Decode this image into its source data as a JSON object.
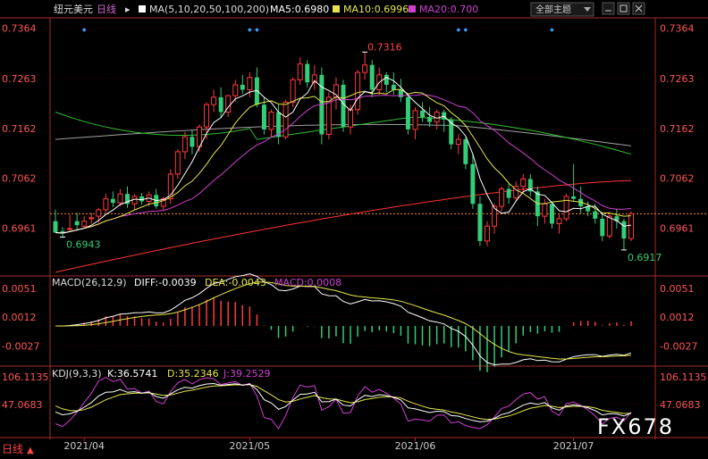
{
  "header": {
    "symbol": "纽元美元",
    "period": "日线",
    "ma_label": "MA(5,10,20,50,100,200)",
    "ma5": "MA5:0.6980",
    "ma10": "MA10:0.6996",
    "ma20": "MA20:0.700",
    "layout_select": "全部主题"
  },
  "macd_legend": {
    "title": "MACD(26,12,9)",
    "diff": "DIFF:-0.0039",
    "dea": "DEA:-0.0043",
    "macd": "MACD:0.0008"
  },
  "kdj_legend": {
    "title": "KDJ(9,3,3)",
    "k": "K:36.5741",
    "d": "D:35.2346",
    "j": "J:39.2529"
  },
  "bottom": {
    "period_label": "日线"
  },
  "watermark": "FX678",
  "colors": {
    "up": "#ff3b3b",
    "down": "#33cc77",
    "ma5": "#ffffff",
    "ma10": "#e6e64c",
    "ma20": "#d040d0",
    "ma50": "#30c030",
    "ma100": "#a0a0a0",
    "ma200": "#ff3333",
    "grid": "#3a0000",
    "axis": "#aa2a2a"
  },
  "chart_data": [
    {
      "type": "candlestick",
      "yticks": [
        "0.7364",
        "0.7263",
        "0.7162",
        "0.7062",
        "0.6961"
      ],
      "ylim": [
        0.687,
        0.7385
      ],
      "xticks": [
        "2021/04",
        "2021/05",
        "2021/06",
        "2021/07"
      ],
      "xtick_index": [
        4,
        27,
        50,
        72
      ],
      "high_annotation": {
        "label": "0.7316",
        "index": 43,
        "value": 0.7316
      },
      "low_annotations": [
        {
          "label": "0.6943",
          "index": 1,
          "value": 0.6943
        },
        {
          "label": "0.6917",
          "index": 79,
          "value": 0.6917
        }
      ],
      "ohlc": [
        [
          0.6975,
          0.6998,
          0.6955,
          0.6952
        ],
        [
          0.6955,
          0.6963,
          0.6943,
          0.695
        ],
        [
          0.696,
          0.6988,
          0.6955,
          0.696
        ],
        [
          0.6975,
          0.6992,
          0.6958,
          0.6967
        ],
        [
          0.6965,
          0.6985,
          0.696,
          0.6975
        ],
        [
          0.698,
          0.6992,
          0.697,
          0.6982
        ],
        [
          0.6985,
          0.7002,
          0.6972,
          0.6998
        ],
        [
          0.6998,
          0.703,
          0.6992,
          0.702
        ],
        [
          0.702,
          0.7035,
          0.7003,
          0.7012
        ],
        [
          0.7012,
          0.704,
          0.7005,
          0.703
        ],
        [
          0.703,
          0.7045,
          0.7002,
          0.701
        ],
        [
          0.701,
          0.703,
          0.6998,
          0.7025
        ],
        [
          0.7025,
          0.7032,
          0.7008,
          0.7015
        ],
        [
          0.7015,
          0.7035,
          0.7005,
          0.7028
        ],
        [
          0.7028,
          0.704,
          0.7,
          0.7005
        ],
        [
          0.7005,
          0.7025,
          0.6995,
          0.702
        ],
        [
          0.702,
          0.708,
          0.701,
          0.707
        ],
        [
          0.707,
          0.712,
          0.706,
          0.7115
        ],
        [
          0.7115,
          0.7155,
          0.71,
          0.7145
        ],
        [
          0.7145,
          0.716,
          0.711,
          0.7125
        ],
        [
          0.7125,
          0.717,
          0.7115,
          0.7165
        ],
        [
          0.7165,
          0.7215,
          0.714,
          0.721
        ],
        [
          0.721,
          0.724,
          0.7195,
          0.7225
        ],
        [
          0.7225,
          0.7245,
          0.7185,
          0.7195
        ],
        [
          0.7195,
          0.723,
          0.7185,
          0.7228
        ],
        [
          0.7228,
          0.726,
          0.7215,
          0.725
        ],
        [
          0.725,
          0.727,
          0.7232,
          0.724
        ],
        [
          0.724,
          0.7275,
          0.7225,
          0.7265
        ],
        [
          0.7265,
          0.7285,
          0.7205,
          0.721
        ],
        [
          0.721,
          0.7225,
          0.715,
          0.716
        ],
        [
          0.716,
          0.72,
          0.7145,
          0.7195
        ],
        [
          0.7195,
          0.721,
          0.713,
          0.7145
        ],
        [
          0.7145,
          0.722,
          0.714,
          0.7215
        ],
        [
          0.7215,
          0.7265,
          0.7205,
          0.726
        ],
        [
          0.726,
          0.7305,
          0.725,
          0.7292
        ],
        [
          0.7292,
          0.73,
          0.7245,
          0.7255
        ],
        [
          0.7255,
          0.729,
          0.724,
          0.727
        ],
        [
          0.727,
          0.7285,
          0.713,
          0.715
        ],
        [
          0.715,
          0.7235,
          0.714,
          0.7225
        ],
        [
          0.7225,
          0.7265,
          0.72,
          0.725
        ],
        [
          0.725,
          0.726,
          0.7155,
          0.7165
        ],
        [
          0.7165,
          0.721,
          0.715,
          0.72
        ],
        [
          0.72,
          0.728,
          0.719,
          0.7275
        ],
        [
          0.7275,
          0.7316,
          0.726,
          0.729
        ],
        [
          0.729,
          0.73,
          0.7225,
          0.724
        ],
        [
          0.724,
          0.7285,
          0.723,
          0.727
        ],
        [
          0.727,
          0.7275,
          0.7235,
          0.725
        ],
        [
          0.725,
          0.7275,
          0.723,
          0.724
        ],
        [
          0.724,
          0.7262,
          0.7215,
          0.7225
        ],
        [
          0.7225,
          0.7232,
          0.715,
          0.716
        ],
        [
          0.716,
          0.7205,
          0.714,
          0.7198
        ],
        [
          0.7198,
          0.7215,
          0.7175,
          0.7185
        ],
        [
          0.7185,
          0.7205,
          0.7165,
          0.7175
        ],
        [
          0.7175,
          0.72,
          0.716,
          0.7195
        ],
        [
          0.7195,
          0.72,
          0.7155,
          0.718
        ],
        [
          0.718,
          0.7185,
          0.712,
          0.713
        ],
        [
          0.713,
          0.715,
          0.711,
          0.714
        ],
        [
          0.714,
          0.7145,
          0.708,
          0.709
        ],
        [
          0.709,
          0.711,
          0.7,
          0.701
        ],
        [
          0.701,
          0.7025,
          0.6925,
          0.6935
        ],
        [
          0.6935,
          0.6975,
          0.6925,
          0.6965
        ],
        [
          0.6965,
          0.701,
          0.695,
          0.7005
        ],
        [
          0.7005,
          0.7045,
          0.6995,
          0.704
        ],
        [
          0.704,
          0.705,
          0.701,
          0.7022
        ],
        [
          0.7022,
          0.7055,
          0.7015,
          0.7045
        ],
        [
          0.7045,
          0.707,
          0.703,
          0.706
        ],
        [
          0.706,
          0.707,
          0.7025,
          0.7035
        ],
        [
          0.7035,
          0.7045,
          0.6965,
          0.6985
        ],
        [
          0.6985,
          0.702,
          0.697,
          0.701
        ],
        [
          0.701,
          0.7015,
          0.696,
          0.697
        ],
        [
          0.697,
          0.699,
          0.695,
          0.698
        ],
        [
          0.698,
          0.703,
          0.6975,
          0.7025
        ],
        [
          0.7025,
          0.709,
          0.7015,
          0.702
        ],
        [
          0.702,
          0.7045,
          0.699,
          0.7005
        ],
        [
          0.7005,
          0.7015,
          0.6985,
          0.6995
        ],
        [
          0.6995,
          0.701,
          0.697,
          0.698
        ],
        [
          0.698,
          0.699,
          0.6935,
          0.6945
        ],
        [
          0.6945,
          0.699,
          0.694,
          0.6985
        ],
        [
          0.6985,
          0.7,
          0.696,
          0.6975
        ],
        [
          0.6975,
          0.698,
          0.6917,
          0.694
        ],
        [
          0.694,
          0.6995,
          0.6935,
          0.699
        ]
      ]
    },
    {
      "type": "bar",
      "title": "MACD(26,12,9)",
      "yticks": [
        "0.0051",
        "0.0012",
        "-0.0027"
      ],
      "ylim": [
        -0.0052,
        0.0064
      ]
    },
    {
      "type": "line",
      "title": "KDJ(9,3,3)",
      "yticks": [
        "106.1135",
        "47.0683"
      ],
      "ylim": [
        -20,
        125
      ]
    }
  ]
}
